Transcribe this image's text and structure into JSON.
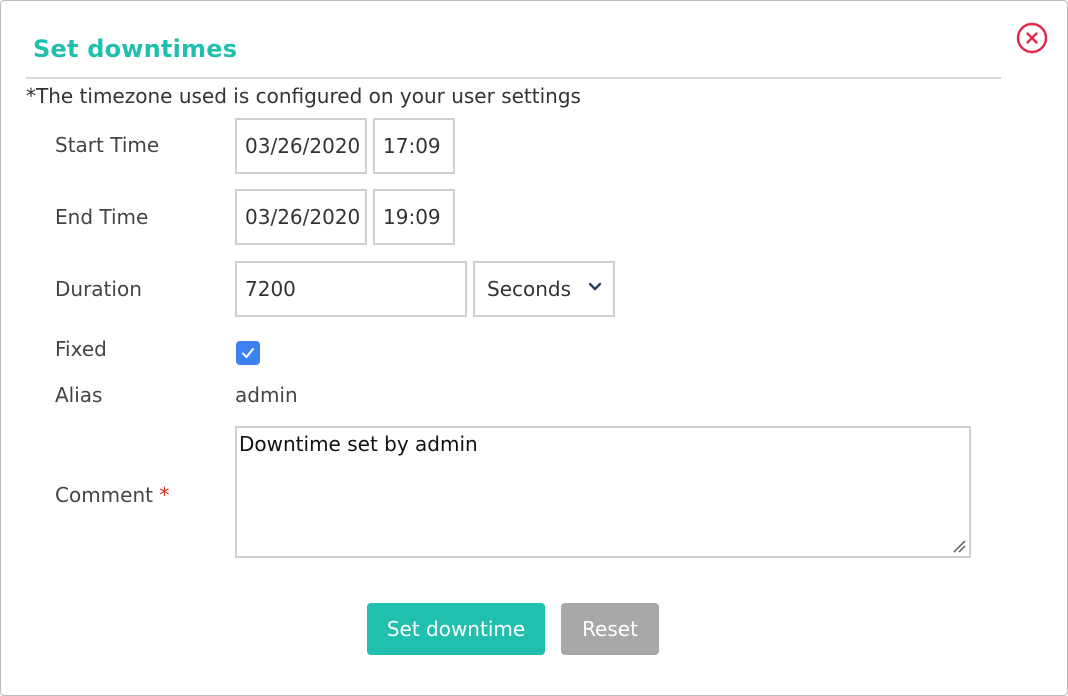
{
  "dialog": {
    "title": "Set downtimes",
    "note": "*The timezone used is configured on your user settings"
  },
  "form": {
    "start_time": {
      "label": "Start Time",
      "date_value": "03/26/2020",
      "time_value": "17:09"
    },
    "end_time": {
      "label": "End Time",
      "date_value": "03/26/2020",
      "time_value": "19:09"
    },
    "duration": {
      "label": "Duration",
      "value": "7200",
      "unit_selected": "Seconds"
    },
    "fixed": {
      "label": "Fixed",
      "checked": true
    },
    "alias": {
      "label": "Alias",
      "value": "admin"
    },
    "comment": {
      "label": "Comment",
      "required_marker": "*",
      "value": "Downtime set by admin"
    }
  },
  "buttons": {
    "submit_label": "Set downtime",
    "reset_label": "Reset"
  },
  "colors": {
    "accent": "#21bfae",
    "checkbox": "#3b82f0",
    "close_icon": "#e0284a",
    "reset_button": "#a8a8a8",
    "required": "#e0281e"
  },
  "icons": {
    "close": "close-circle-icon",
    "select": "chevron-down-icon",
    "checkbox": "checkmark-icon",
    "textarea_resize": "resize-grip-icon"
  }
}
